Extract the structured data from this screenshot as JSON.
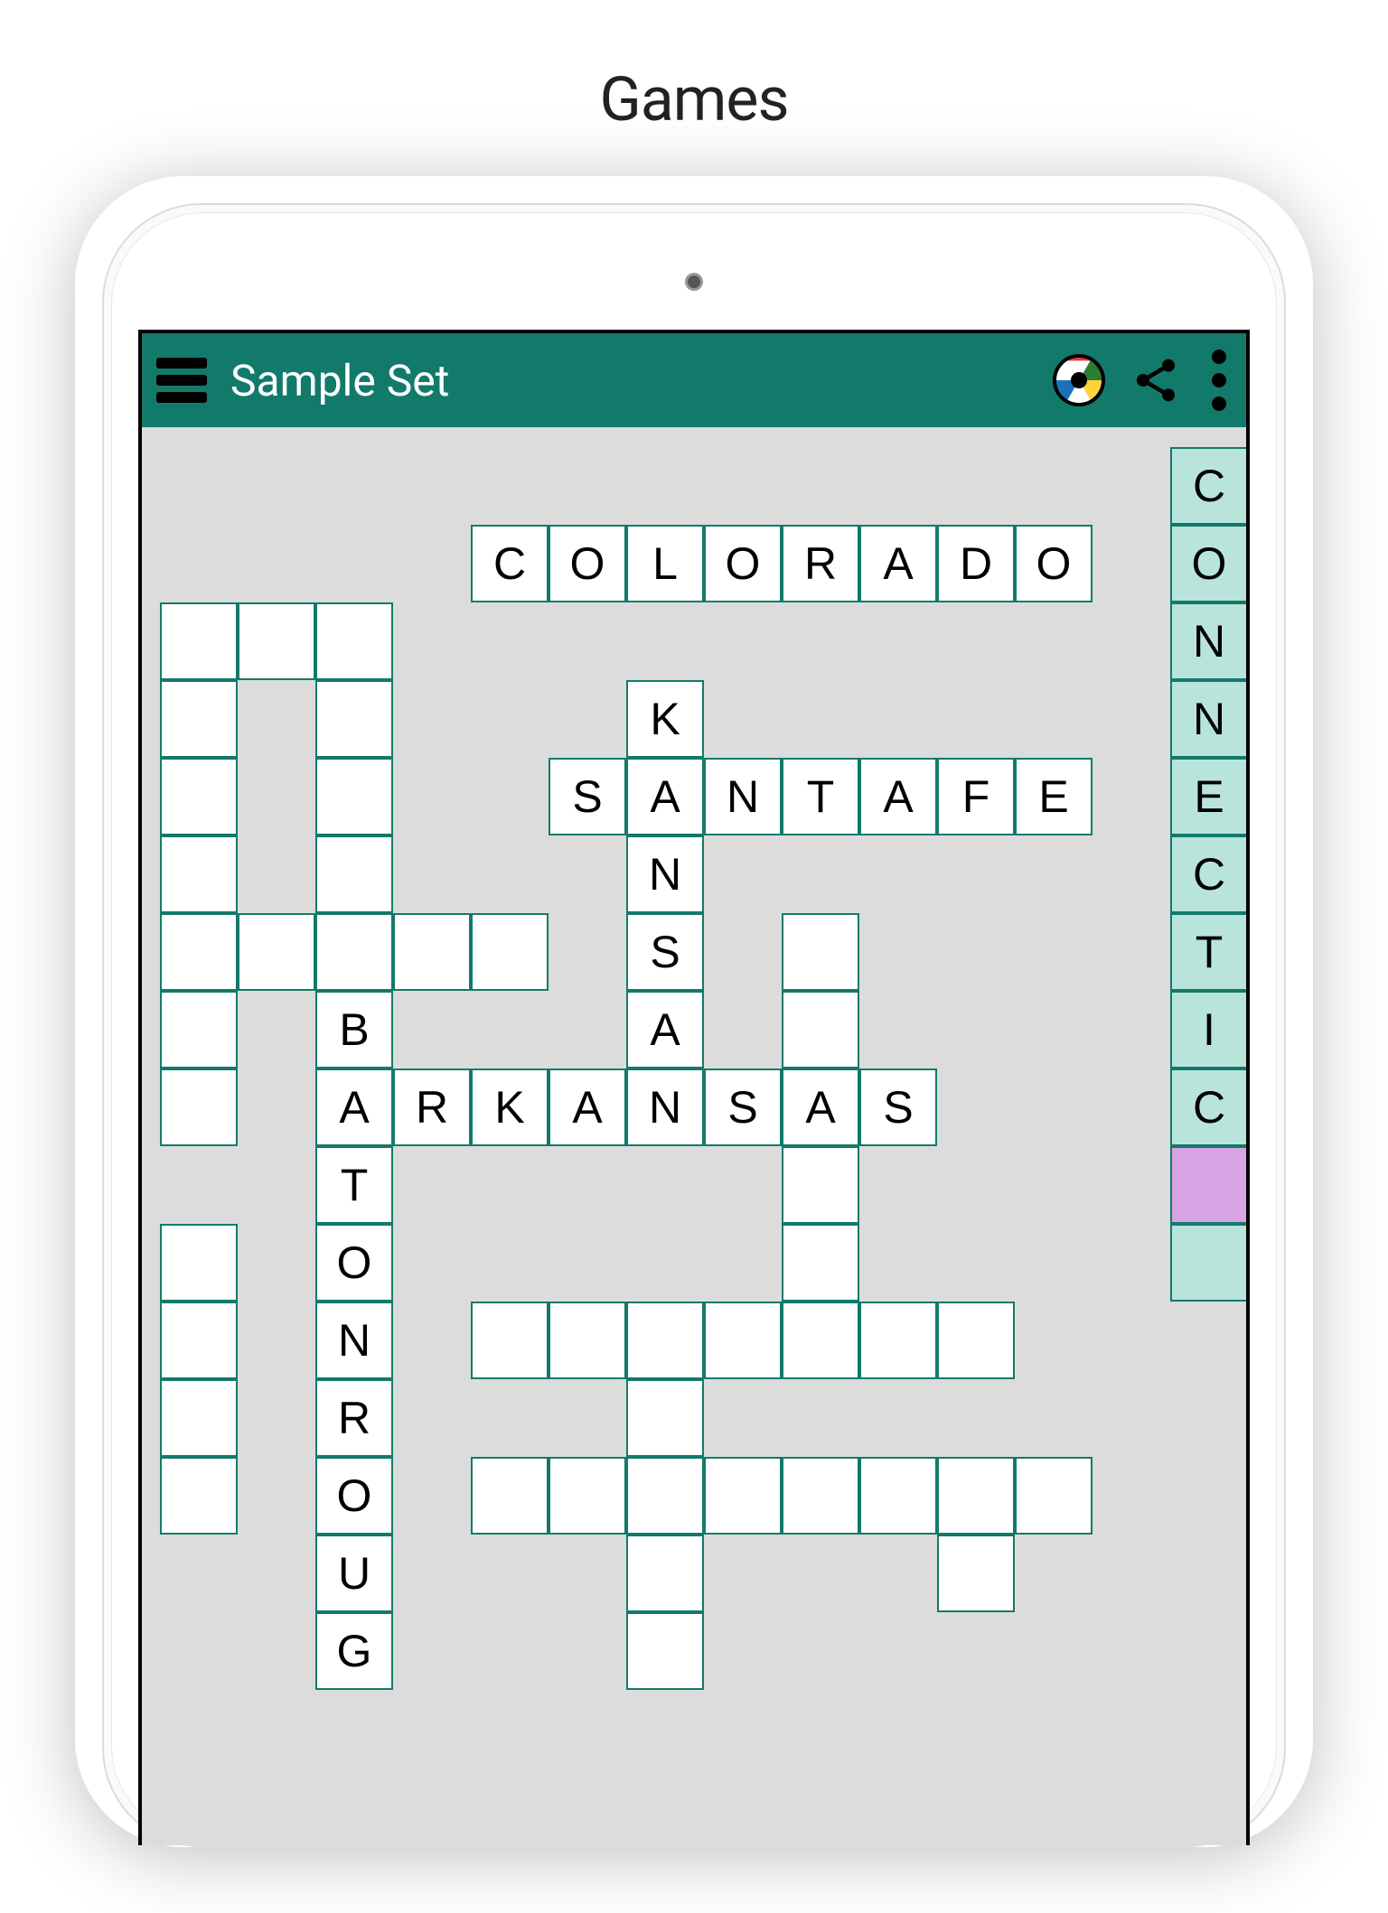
{
  "page_title": "Games",
  "app_bar": {
    "title": "Sample Set"
  },
  "colors": {
    "bar": "#127a6b",
    "grid_bg": "#dcdcdc",
    "cell_border": "#127a6b",
    "highlight": "#b9e4dc",
    "selected": "#d9a4e4"
  },
  "grid": {
    "cols": 14,
    "rows": 21,
    "cell_size": 86,
    "cells": [
      {
        "r": 0,
        "c": 13,
        "t": "C",
        "hl": true
      },
      {
        "r": 1,
        "c": 4,
        "t": "C"
      },
      {
        "r": 1,
        "c": 5,
        "t": "O"
      },
      {
        "r": 1,
        "c": 6,
        "t": "L"
      },
      {
        "r": 1,
        "c": 7,
        "t": "O"
      },
      {
        "r": 1,
        "c": 8,
        "t": "R"
      },
      {
        "r": 1,
        "c": 9,
        "t": "A"
      },
      {
        "r": 1,
        "c": 10,
        "t": "D"
      },
      {
        "r": 1,
        "c": 11,
        "t": "O"
      },
      {
        "r": 1,
        "c": 13,
        "t": "O",
        "hl": true
      },
      {
        "r": 2,
        "c": 0,
        "t": ""
      },
      {
        "r": 2,
        "c": 1,
        "t": ""
      },
      {
        "r": 2,
        "c": 2,
        "t": ""
      },
      {
        "r": 2,
        "c": 13,
        "t": "N",
        "hl": true
      },
      {
        "r": 3,
        "c": 0,
        "t": ""
      },
      {
        "r": 3,
        "c": 2,
        "t": ""
      },
      {
        "r": 3,
        "c": 6,
        "t": "K"
      },
      {
        "r": 3,
        "c": 13,
        "t": "N",
        "hl": true
      },
      {
        "r": 4,
        "c": 0,
        "t": ""
      },
      {
        "r": 4,
        "c": 2,
        "t": ""
      },
      {
        "r": 4,
        "c": 5,
        "t": "S"
      },
      {
        "r": 4,
        "c": 6,
        "t": "A"
      },
      {
        "r": 4,
        "c": 7,
        "t": "N"
      },
      {
        "r": 4,
        "c": 8,
        "t": "T"
      },
      {
        "r": 4,
        "c": 9,
        "t": "A"
      },
      {
        "r": 4,
        "c": 10,
        "t": "F"
      },
      {
        "r": 4,
        "c": 11,
        "t": "E"
      },
      {
        "r": 4,
        "c": 13,
        "t": "E",
        "hl": true
      },
      {
        "r": 5,
        "c": 0,
        "t": ""
      },
      {
        "r": 5,
        "c": 2,
        "t": ""
      },
      {
        "r": 5,
        "c": 6,
        "t": "N"
      },
      {
        "r": 5,
        "c": 13,
        "t": "C",
        "hl": true
      },
      {
        "r": 6,
        "c": 0,
        "t": ""
      },
      {
        "r": 6,
        "c": 1,
        "t": ""
      },
      {
        "r": 6,
        "c": 2,
        "t": ""
      },
      {
        "r": 6,
        "c": 3,
        "t": ""
      },
      {
        "r": 6,
        "c": 4,
        "t": ""
      },
      {
        "r": 6,
        "c": 6,
        "t": "S"
      },
      {
        "r": 6,
        "c": 8,
        "t": ""
      },
      {
        "r": 6,
        "c": 13,
        "t": "T",
        "hl": true
      },
      {
        "r": 7,
        "c": 0,
        "t": ""
      },
      {
        "r": 7,
        "c": 2,
        "t": "B"
      },
      {
        "r": 7,
        "c": 6,
        "t": "A"
      },
      {
        "r": 7,
        "c": 8,
        "t": ""
      },
      {
        "r": 7,
        "c": 13,
        "t": "I",
        "hl": true
      },
      {
        "r": 8,
        "c": 0,
        "t": ""
      },
      {
        "r": 8,
        "c": 2,
        "t": "A"
      },
      {
        "r": 8,
        "c": 3,
        "t": "R"
      },
      {
        "r": 8,
        "c": 4,
        "t": "K"
      },
      {
        "r": 8,
        "c": 5,
        "t": "A"
      },
      {
        "r": 8,
        "c": 6,
        "t": "N"
      },
      {
        "r": 8,
        "c": 7,
        "t": "S"
      },
      {
        "r": 8,
        "c": 8,
        "t": "A"
      },
      {
        "r": 8,
        "c": 9,
        "t": "S"
      },
      {
        "r": 8,
        "c": 13,
        "t": "C",
        "hl": true
      },
      {
        "r": 9,
        "c": 2,
        "t": "T"
      },
      {
        "r": 9,
        "c": 8,
        "t": ""
      },
      {
        "r": 9,
        "c": 13,
        "t": "",
        "sel": true
      },
      {
        "r": 10,
        "c": 0,
        "t": ""
      },
      {
        "r": 10,
        "c": 2,
        "t": "O"
      },
      {
        "r": 10,
        "c": 8,
        "t": ""
      },
      {
        "r": 10,
        "c": 13,
        "t": "",
        "hl": true
      },
      {
        "r": 11,
        "c": 0,
        "t": ""
      },
      {
        "r": 11,
        "c": 2,
        "t": "N"
      },
      {
        "r": 11,
        "c": 4,
        "t": ""
      },
      {
        "r": 11,
        "c": 5,
        "t": ""
      },
      {
        "r": 11,
        "c": 6,
        "t": ""
      },
      {
        "r": 11,
        "c": 7,
        "t": ""
      },
      {
        "r": 11,
        "c": 8,
        "t": ""
      },
      {
        "r": 11,
        "c": 9,
        "t": ""
      },
      {
        "r": 11,
        "c": 10,
        "t": ""
      },
      {
        "r": 12,
        "c": 0,
        "t": ""
      },
      {
        "r": 12,
        "c": 2,
        "t": "R"
      },
      {
        "r": 12,
        "c": 6,
        "t": ""
      },
      {
        "r": 13,
        "c": 0,
        "t": ""
      },
      {
        "r": 13,
        "c": 2,
        "t": "O"
      },
      {
        "r": 13,
        "c": 4,
        "t": ""
      },
      {
        "r": 13,
        "c": 5,
        "t": ""
      },
      {
        "r": 13,
        "c": 6,
        "t": ""
      },
      {
        "r": 13,
        "c": 7,
        "t": ""
      },
      {
        "r": 13,
        "c": 8,
        "t": ""
      },
      {
        "r": 13,
        "c": 9,
        "t": ""
      },
      {
        "r": 13,
        "c": 10,
        "t": ""
      },
      {
        "r": 13,
        "c": 11,
        "t": ""
      },
      {
        "r": 14,
        "c": 2,
        "t": "U"
      },
      {
        "r": 14,
        "c": 6,
        "t": ""
      },
      {
        "r": 14,
        "c": 10,
        "t": ""
      },
      {
        "r": 15,
        "c": 2,
        "t": "G"
      },
      {
        "r": 15,
        "c": 6,
        "t": ""
      }
    ]
  }
}
